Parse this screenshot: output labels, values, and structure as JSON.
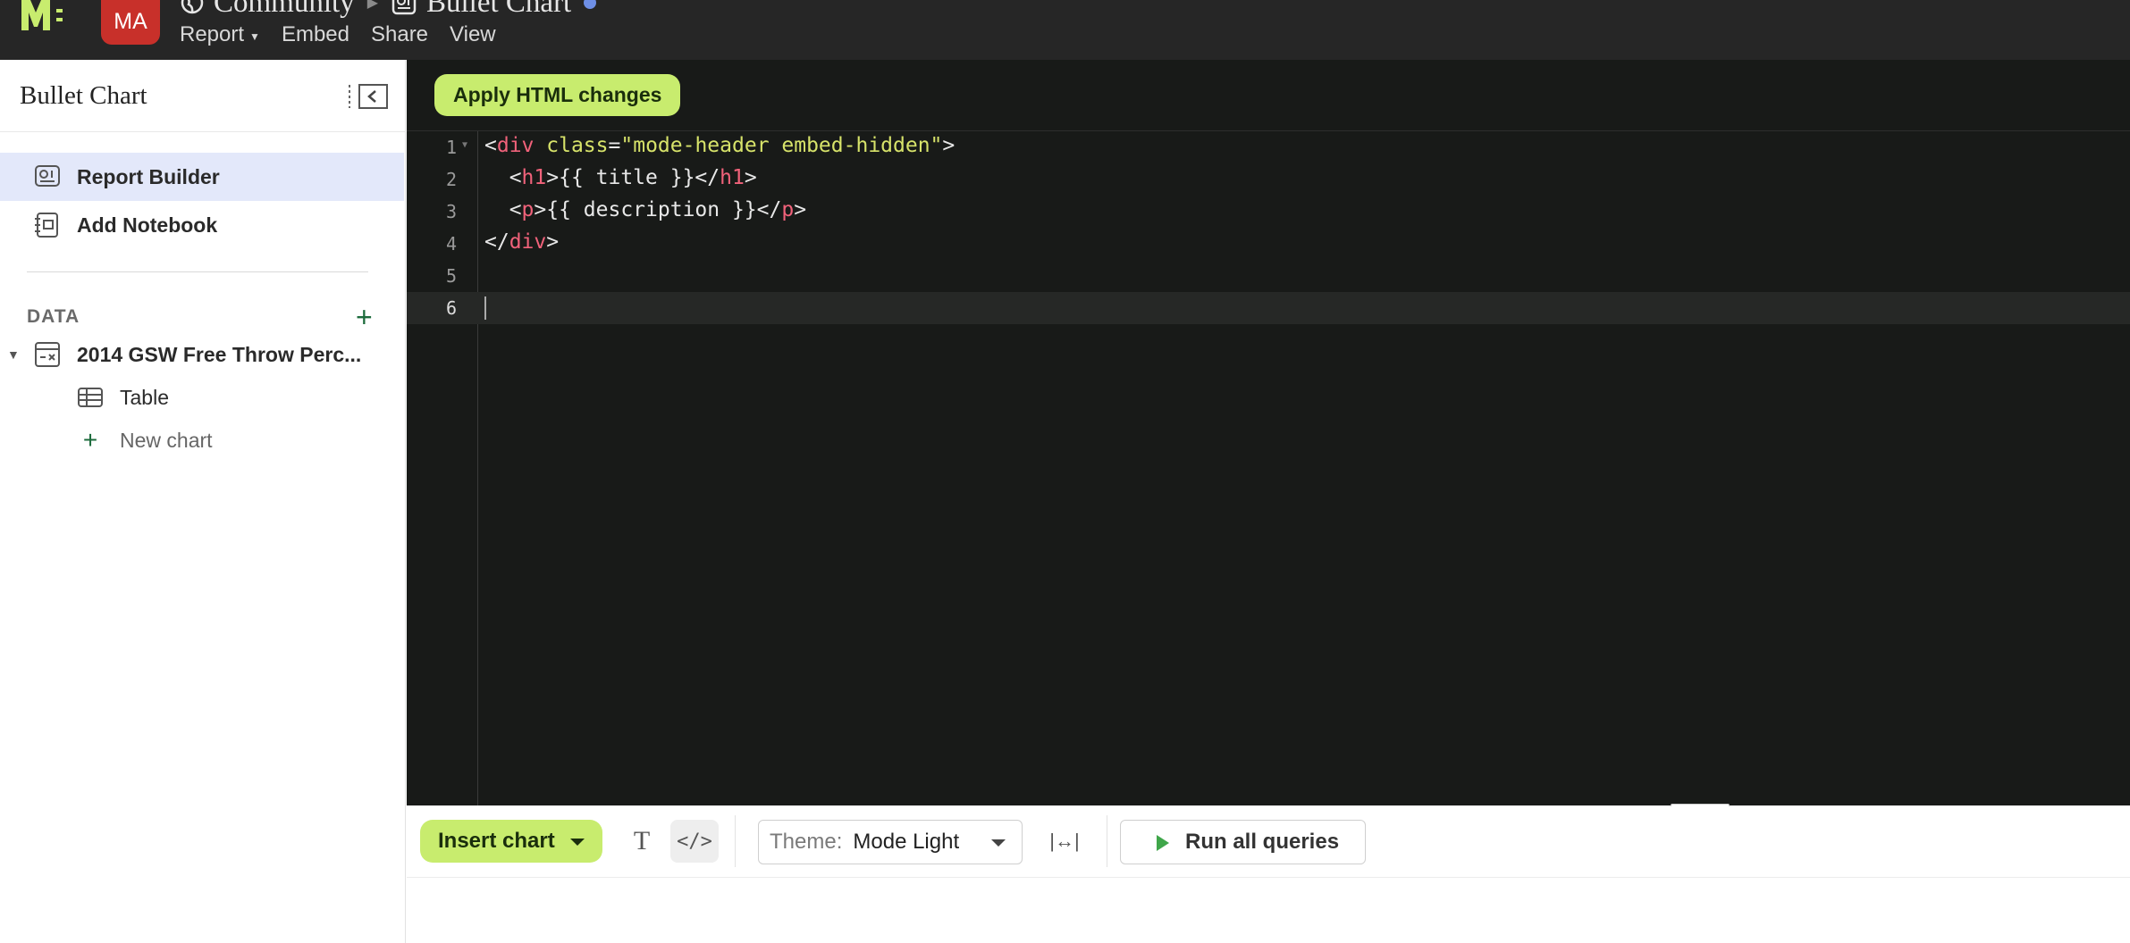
{
  "header": {
    "avatar_initials": "MA",
    "breadcrumb_workspace": "Community",
    "breadcrumb_report": "Bullet Chart",
    "menu": [
      "Report",
      "Embed",
      "Share",
      "View"
    ]
  },
  "sidebar": {
    "title": "Bullet Chart",
    "items": [
      {
        "label": "Report Builder",
        "icon": "report-builder-icon",
        "active": true
      },
      {
        "label": "Add Notebook",
        "icon": "notebook-icon",
        "active": false
      }
    ],
    "data_section_label": "DATA",
    "query": {
      "label": "2014 GSW Free Throw Perc...",
      "children": [
        {
          "label": "Table",
          "icon": "table-icon"
        },
        {
          "label": "New chart",
          "icon": "plus-icon"
        }
      ]
    }
  },
  "editor": {
    "apply_label": "Apply HTML changes",
    "current_line": 6,
    "lines": [
      "<div class=\"mode-header embed-hidden\">",
      "  <h1>{{ title }}</h1>",
      "  <p>{{ description }}</p>",
      "</div>",
      "",
      ""
    ]
  },
  "bottom_toolbar": {
    "insert_chart_label": "Insert chart",
    "text_icon": "T",
    "code_icon": "</>",
    "theme_label": "Theme:",
    "theme_value": "Mode Light",
    "width_icon": "|↔|",
    "run_label": "Run all queries"
  },
  "colors": {
    "topbar": "#262626",
    "accent_green": "#c8ec6e",
    "avatar_red": "#c8302a",
    "editor_bg": "#181a18",
    "active_item": "#e3e8fa"
  }
}
